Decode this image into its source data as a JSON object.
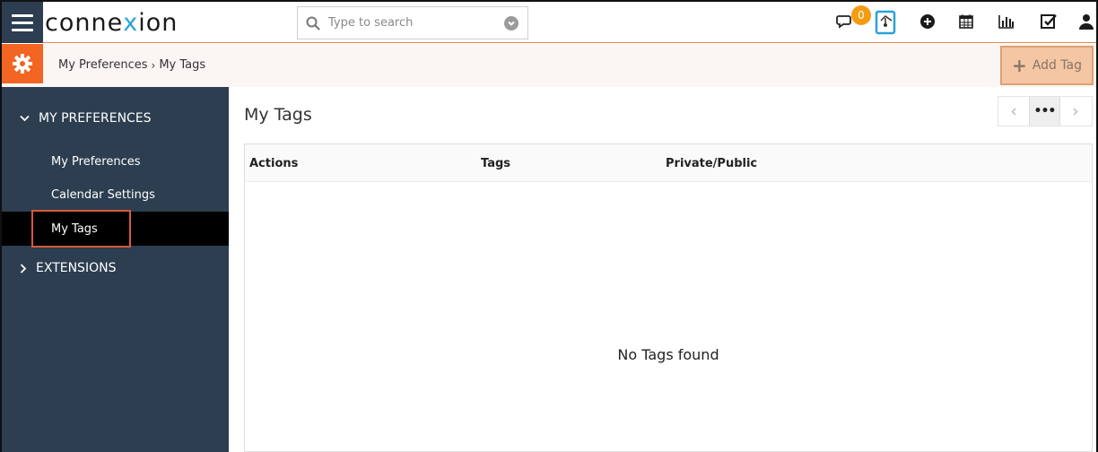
{
  "header": {
    "logo_prefix": "conne",
    "logo_x": "x",
    "logo_suffix": "ion",
    "search_placeholder": "Type to search",
    "notification_count": "0"
  },
  "breadcrumb": {
    "parent": "My Preferences",
    "current": "My Tags"
  },
  "toolbar": {
    "add_tag_label": "Add Tag"
  },
  "sidebar": {
    "section_preferences": "MY PREFERENCES",
    "items": [
      {
        "label": "My Preferences"
      },
      {
        "label": "Calendar Settings"
      },
      {
        "label": "My Tags"
      }
    ],
    "section_extensions": "EXTENSIONS"
  },
  "main": {
    "title": "My Tags",
    "pager_more": "•••",
    "columns": [
      "Actions",
      "Tags",
      "Private/Public"
    ],
    "empty_message": "No Tags found"
  },
  "colors": {
    "sidebar_bg": "#2c3e50",
    "accent": "#f26522",
    "logo_x": "#29a3d8"
  }
}
